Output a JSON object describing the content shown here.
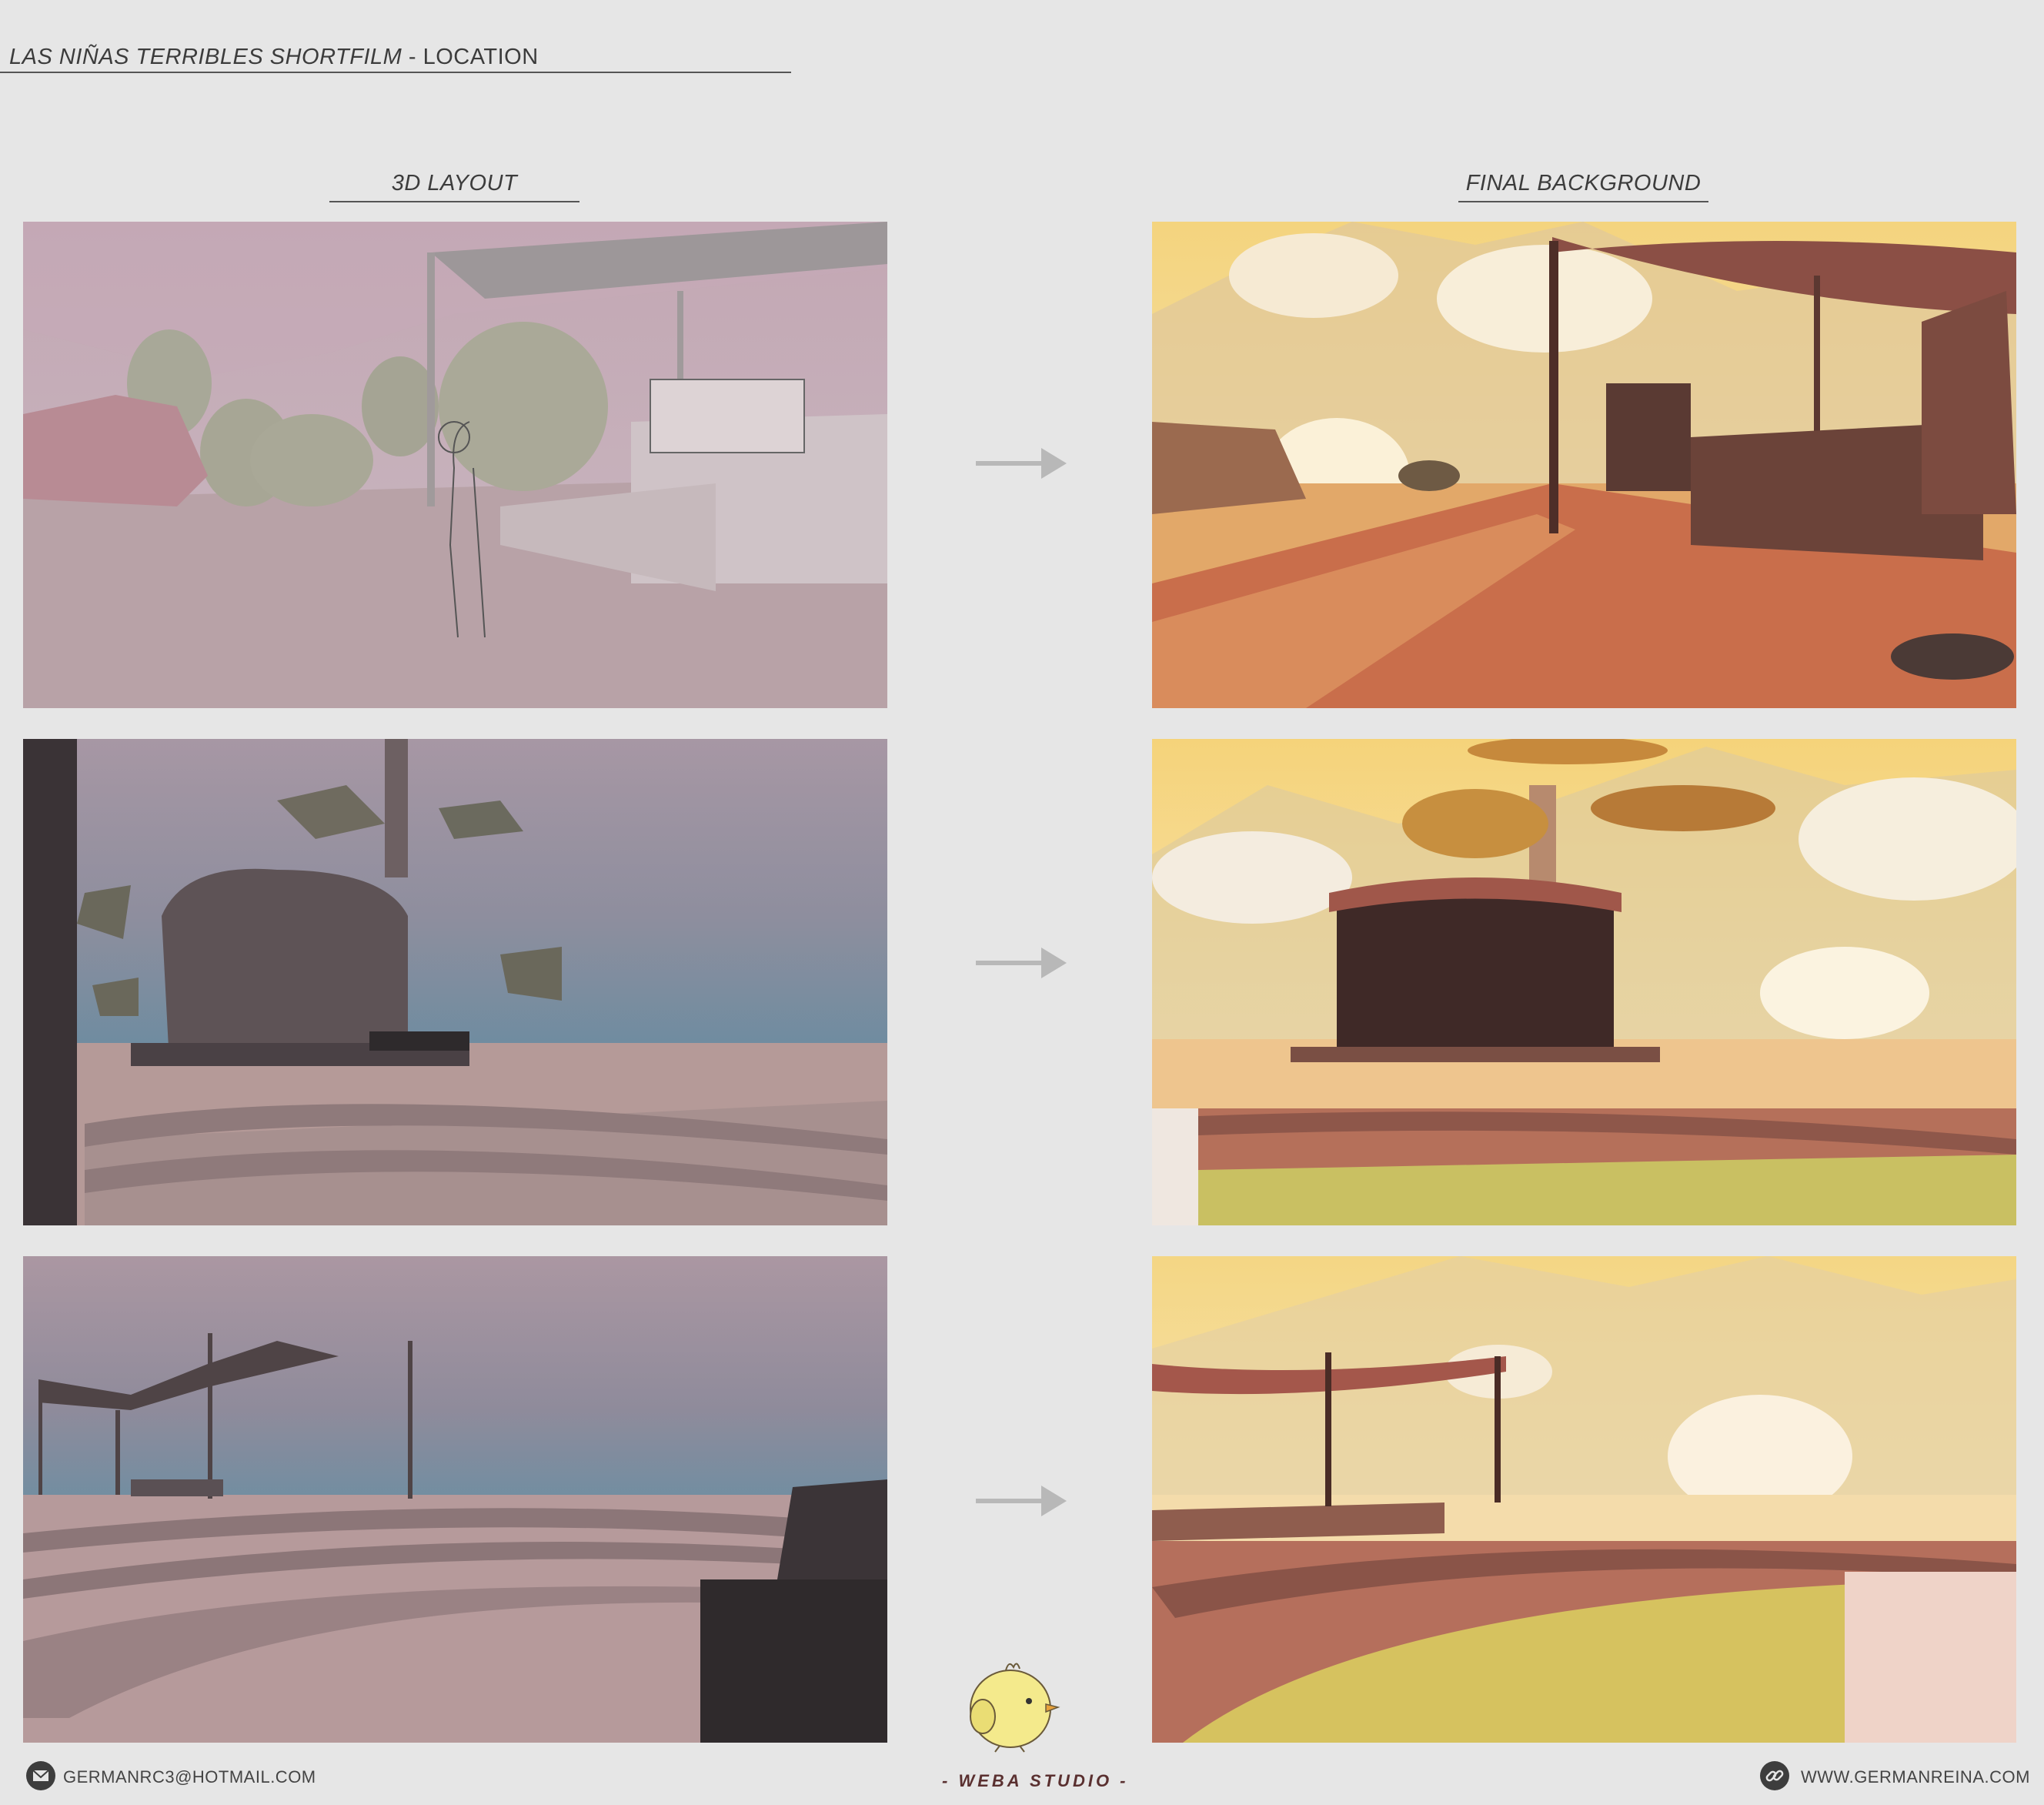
{
  "header": {
    "title_main": "LAS NIÑAS TERRIBLES SHORTFILM",
    "title_suffix": " - LOCATION"
  },
  "columns": {
    "left": "3D LAYOUT",
    "right": "FINAL BACKGROUND"
  },
  "footer": {
    "email": "GERMANRC3@HOTMAIL.COM",
    "website": "WWW.GERMANREINA.COM",
    "studio": "- WEBA STUDIO -"
  },
  "icons": {
    "email": "envelope-icon",
    "website": "link-icon",
    "arrow": "arrow-right-icon"
  },
  "colors": {
    "background": "#e6e6e6",
    "layout_sky": "#b9a7b0",
    "final_sky": "#f3dcb0",
    "final_ground": "#d9955e",
    "arrow": "#b8b8b8"
  }
}
